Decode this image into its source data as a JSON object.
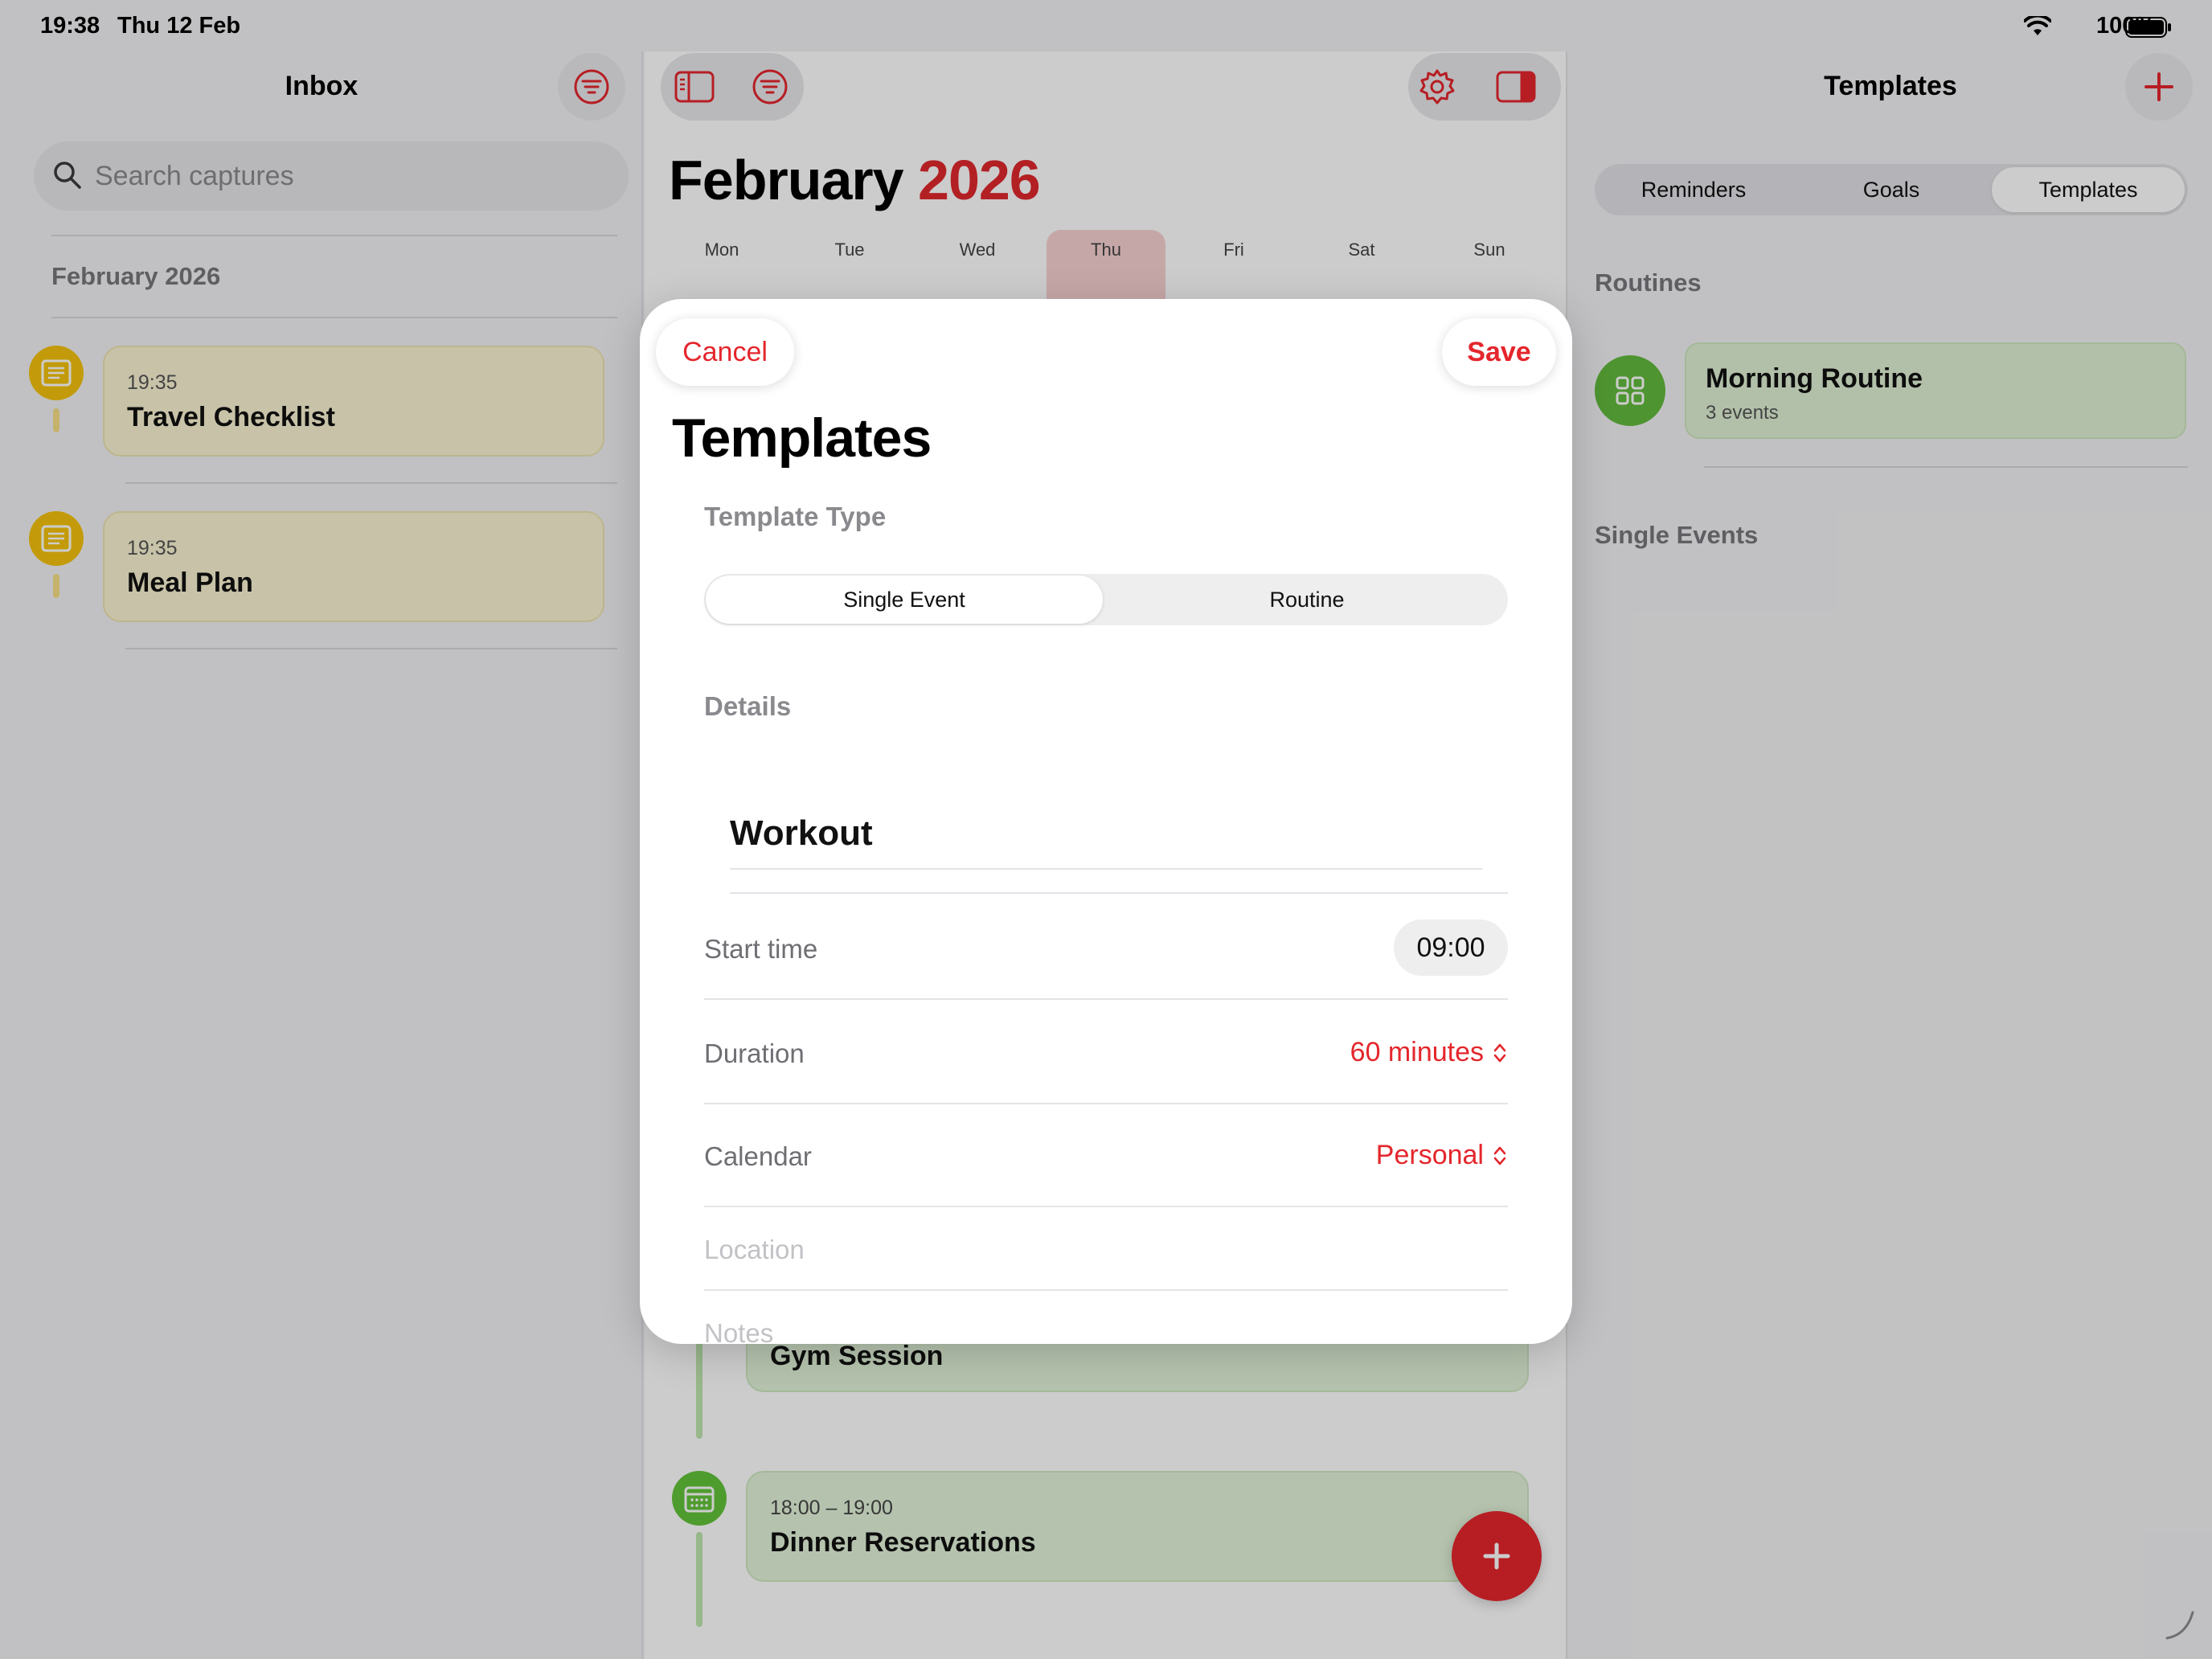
{
  "status_bar": {
    "time": "19:38",
    "date": "Thu 12 Feb",
    "battery": "100%"
  },
  "inbox": {
    "title": "Inbox",
    "search_placeholder": "Search captures",
    "section": "February 2026",
    "items": [
      {
        "time": "19:35",
        "title": "Travel Checklist"
      },
      {
        "time": "19:35",
        "title": "Meal Plan"
      }
    ]
  },
  "calendar": {
    "month": "February",
    "year": "2026",
    "weekdays": [
      "Mon",
      "Tue",
      "Wed",
      "Thu",
      "Fri",
      "Sat",
      "Sun"
    ],
    "events": [
      {
        "time": "",
        "title": "Gym Session"
      },
      {
        "time": "18:00 – 19:00",
        "title": "Dinner Reservations"
      }
    ]
  },
  "templates_panel": {
    "title": "Templates",
    "tabs": [
      "Reminders",
      "Goals",
      "Templates"
    ],
    "active_tab": "Templates",
    "routines_header": "Routines",
    "routine": {
      "title": "Morning Routine",
      "subtitle": "3 events"
    },
    "single_events_header": "Single Events"
  },
  "modal": {
    "cancel": "Cancel",
    "save": "Save",
    "title": "Templates",
    "template_type_label": "Template Type",
    "type_options": [
      "Single Event",
      "Routine"
    ],
    "selected_type": "Single Event",
    "details_label": "Details",
    "name_value": "Workout",
    "start_time_label": "Start time",
    "start_time_value": "09:00",
    "duration_label": "Duration",
    "duration_value": "60 minutes",
    "calendar_label": "Calendar",
    "calendar_value": "Personal",
    "location_placeholder": "Location",
    "notes_placeholder": "Notes"
  },
  "colors": {
    "accent_red": "#e4262c",
    "note_yellow": "#f4c20d",
    "event_green": "#62c33a",
    "routine_green": "#62b93c"
  },
  "icons": {
    "sidebar_toggle": "sidebar-left-icon",
    "filter": "filter-icon",
    "settings": "gear-icon",
    "inspector": "sidebar-right-icon",
    "add": "plus-icon",
    "search": "search-icon",
    "note": "note-icon",
    "calendar": "calendar-icon",
    "routine": "grid-icon",
    "chevrons": "chevron-up-down-icon"
  }
}
